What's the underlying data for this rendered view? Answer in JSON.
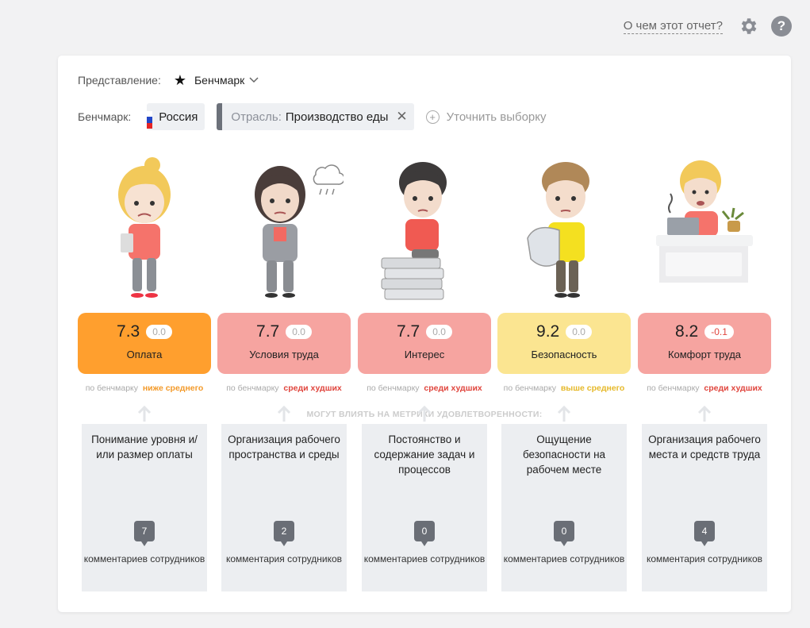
{
  "topbar": {
    "about_link": "О чем этот отчет?",
    "settings_icon": "gear-icon",
    "help_icon": "question-icon",
    "help_label": "?"
  },
  "view": {
    "label": "Представление:",
    "value": "Бенчмарк",
    "icon": "star-icon"
  },
  "benchmark": {
    "label": "Бенчмарк:",
    "country": "Россия",
    "industry_prefix": "Отрасль:",
    "industry_value": "Производство еды",
    "refine_label": "Уточнить выборку"
  },
  "impact_caption": "МОГУТ ВЛИЯТЬ НА МЕТРИКИ УДОВЛЕТВОРЕННОСТИ:",
  "bench_prefix": "по бенчмарку",
  "metrics": [
    {
      "score": "7.3",
      "delta": "0.0",
      "name": "Оплата",
      "status": "ниже среднего",
      "card_color": "#ff9f2e",
      "status_color": "#f39a2a",
      "driver": "Понимание уровня и/или размер оплаты",
      "comments": "7",
      "comments_label": "комментариев сотрудников"
    },
    {
      "score": "7.7",
      "delta": "0.0",
      "name": "Условия труда",
      "status": "среди худших",
      "card_color": "#f6a4a0",
      "status_color": "#e0453d",
      "driver": "Организация рабочего пространства и среды",
      "comments": "2",
      "comments_label": "комментария сотрудников"
    },
    {
      "score": "7.7",
      "delta": "0.0",
      "name": "Интерес",
      "status": "среди худших",
      "card_color": "#f6a4a0",
      "status_color": "#e0453d",
      "driver": "Постоянство и содержание задач и процессов",
      "comments": "0",
      "comments_label": "комментариев сотрудников"
    },
    {
      "score": "9.2",
      "delta": "0.0",
      "name": "Безопасность",
      "status": "выше среднего",
      "card_color": "#fbe591",
      "status_color": "#e6b92a",
      "driver": "Ощущение безопасности на рабочем месте",
      "comments": "0",
      "comments_label": "комментариев сотрудников"
    },
    {
      "score": "8.2",
      "delta": "-0.1",
      "name": "Комфорт труда",
      "status": "среди худших",
      "card_color": "#f6a4a0",
      "status_color": "#e0453d",
      "driver": "Организация рабочего места и средств труда",
      "comments": "4",
      "comments_label": "комментария сотрудников"
    }
  ]
}
